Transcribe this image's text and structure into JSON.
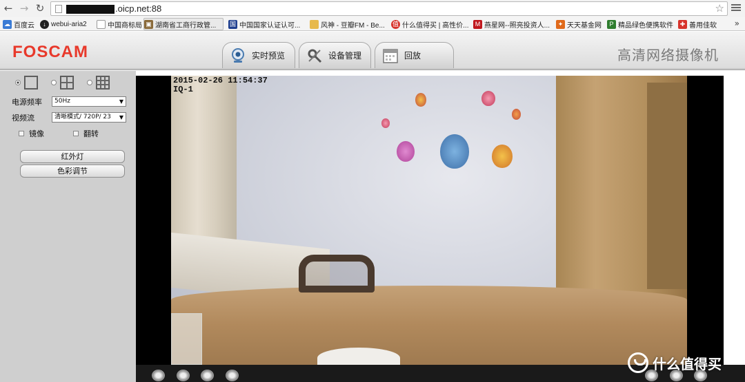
{
  "browser": {
    "url_suffix": ".oicp.net:88",
    "bookmarks": [
      {
        "label": "百度云",
        "icon": "cloud-icon",
        "color": "#3a7bd5"
      },
      {
        "label": "webui-aria2",
        "icon": "download-icon",
        "color": "#222222"
      },
      {
        "label": "中国商标局",
        "icon": "page-icon",
        "color": "#9a9a9a"
      },
      {
        "label": "湖南省工商行政管...",
        "icon": "image-icon",
        "color": "#8a6a3a"
      },
      {
        "label": "中国国家认证认可...",
        "icon": "cert-icon",
        "color": "#1f3f8f"
      },
      {
        "label": "风神 - 豆瓣FM - Be...",
        "icon": "folder-icon",
        "color": "#e7b94c"
      },
      {
        "label": "什么值得买 | 高性价...",
        "icon": "smzdm-icon",
        "color": "#d7332b"
      },
      {
        "label": "燕星网--照亮投资人...",
        "icon": "m-icon",
        "color": "#c0171d"
      },
      {
        "label": "天天基金网",
        "icon": "fund-icon",
        "color": "#e06a1b"
      },
      {
        "label": "精品绿色便携软件",
        "icon": "p-icon",
        "color": "#2f7d2f"
      },
      {
        "label": "善用佳软",
        "icon": "gift-icon",
        "color": "#d7332b"
      }
    ],
    "more_label": "»"
  },
  "app": {
    "logo": "FOSCAM",
    "title": "高清网络摄像机",
    "tabs": [
      {
        "label": "实时预览",
        "icon": "webcam-icon"
      },
      {
        "label": "设备管理",
        "icon": "tools-icon"
      },
      {
        "label": "回放",
        "icon": "calendar-icon"
      }
    ]
  },
  "controls": {
    "freq_label": "电源频率",
    "freq_value": "50Hz",
    "stream_label": "视频流",
    "stream_value": "清晰模式/ 720P/ 23",
    "mirror_label": "镜像",
    "flip_label": "翻转",
    "ir_button": "红外灯",
    "color_button": "色彩调节"
  },
  "video": {
    "timestamp": "2015-02-26 11:54:37",
    "camera_name": "IQ-1"
  },
  "watermark": "什么值得买",
  "colors": {
    "logo": "#e8392b",
    "panel_bg": "#cfcfcf",
    "control_bar": "#1a1a1a"
  }
}
